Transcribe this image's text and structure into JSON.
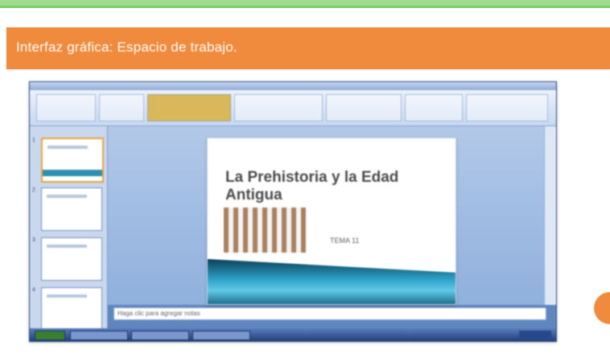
{
  "header": {
    "banner_title": "Interfaz gráfica: Espacio de trabajo."
  },
  "colors": {
    "banner": "#f08a3c",
    "top_strip": "#9fdc8e",
    "window_frame": "#5f86bf",
    "slide_band": "#2da1c7"
  },
  "app_screenshot": {
    "slide": {
      "title": "La Prehistoria y la Edad Antigua",
      "subtitle": "TEMA 11"
    },
    "thumbnails": [
      {
        "num": "1"
      },
      {
        "num": "2"
      },
      {
        "num": "3"
      },
      {
        "num": "4"
      }
    ],
    "notes_placeholder": "Haga clic para agregar notas"
  }
}
